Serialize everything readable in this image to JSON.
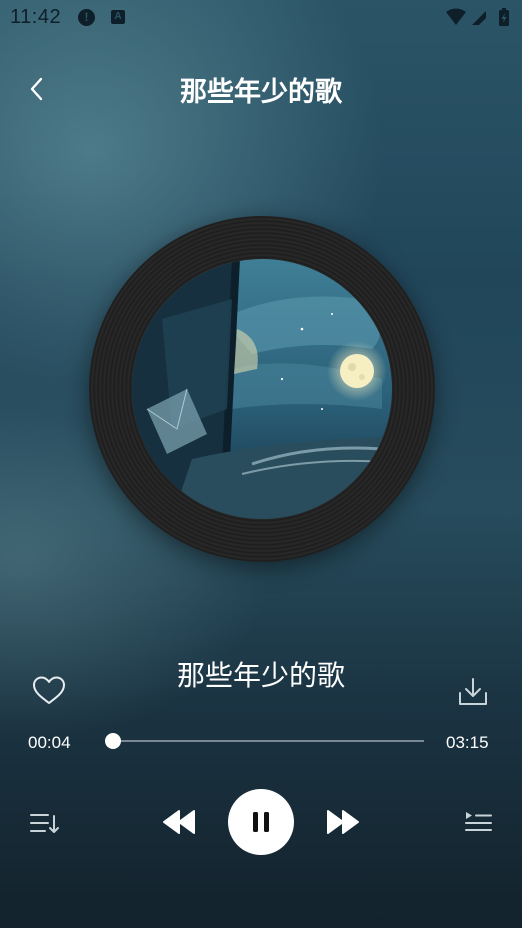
{
  "status_bar": {
    "time": "11:42",
    "alert_glyph": "!",
    "notification_glyph": "A",
    "icons": [
      "wifi-icon",
      "signal-icon",
      "battery-icon"
    ]
  },
  "header": {
    "title": "那些年少的歌",
    "back_icon": "chevron-left-icon"
  },
  "player": {
    "song_title": "那些年少的歌",
    "current_time": "00:04",
    "total_time": "03:15",
    "progress": 0.021,
    "state": "playing"
  },
  "controls": {
    "left_icon": "playlist-sort-icon",
    "prev_icon": "rewind-icon",
    "play_pause_icon": "pause-icon",
    "next_icon": "fast-forward-icon",
    "right_icon": "queue-icon",
    "like_icon": "heart-outline-icon",
    "download_icon": "download-icon"
  },
  "colors": {
    "background_top": "#2b5567",
    "background_bottom": "#13222c",
    "foreground": "#ffffff"
  }
}
